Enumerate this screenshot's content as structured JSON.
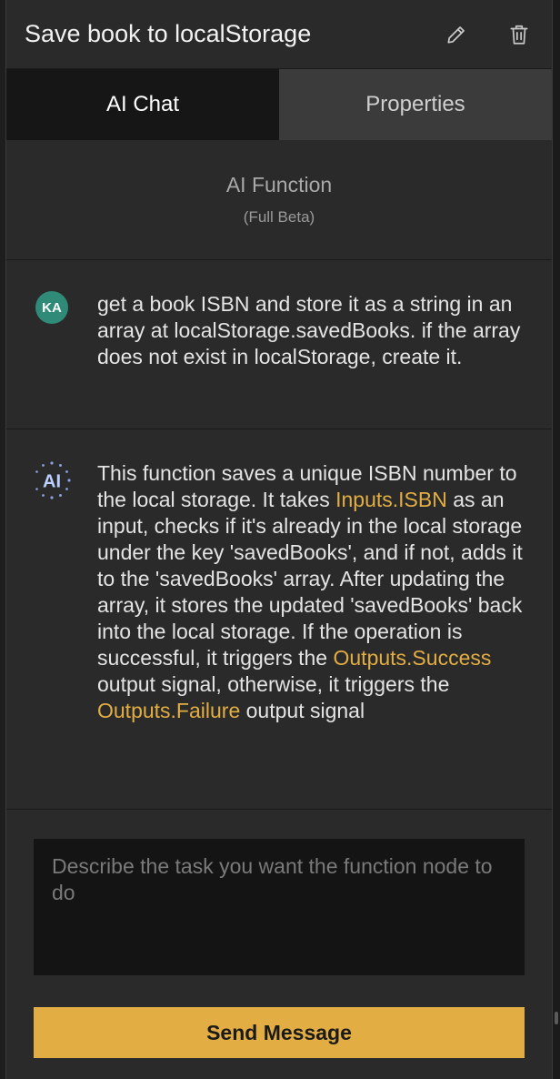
{
  "header": {
    "title": "Save book to localStorage",
    "edit_icon": "pencil-icon",
    "delete_icon": "trash-icon"
  },
  "tabs": [
    {
      "label": "AI Chat",
      "active": true
    },
    {
      "label": "Properties",
      "active": false
    }
  ],
  "ai_function": {
    "title": "AI Function",
    "subtitle": "(Full Beta)"
  },
  "messages": [
    {
      "role": "user",
      "avatar": "KA",
      "text": "get a book ISBN and store it as a string in an array at localStorage.savedBooks. if the array does not exist in localStorage, create it."
    },
    {
      "role": "ai",
      "avatar": "AI",
      "parts": [
        "This function saves a unique ISBN number to the local storage. It takes ",
        "Inputs.ISBN",
        " as an input, checks if it's already in the local storage under the key 'savedBooks', and if not, adds it to the 'savedBooks' array. After updating the array, it stores the updated 'savedBooks' back into the local storage. If the operation is successful, it triggers the ",
        "Outputs.Success",
        " output signal, otherwise, it triggers the ",
        "Outputs.Failure",
        " output signal"
      ]
    }
  ],
  "composer": {
    "placeholder": "Describe the task you want the function node to do",
    "value": "",
    "send_label": "Send Message"
  },
  "colors": {
    "accent": "#e2ad43",
    "avatar_user": "#2f8a78",
    "panel_bg": "#2a2a2a"
  }
}
